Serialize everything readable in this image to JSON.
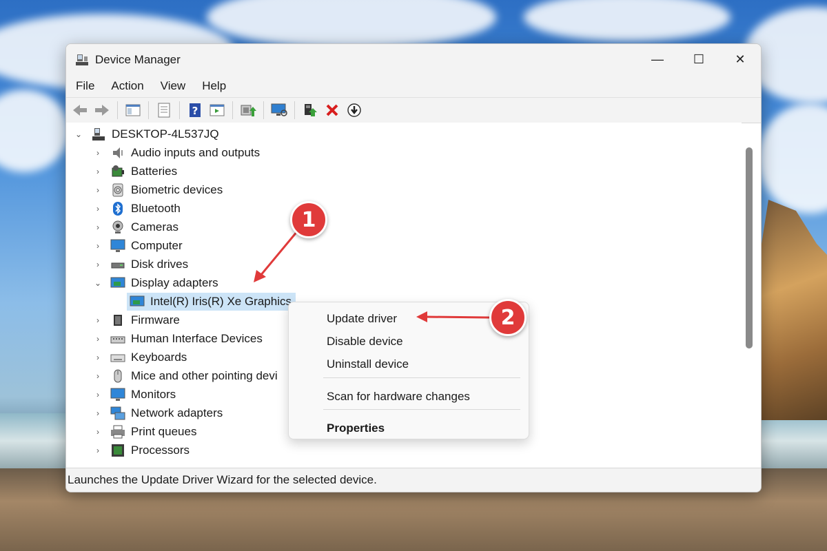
{
  "window": {
    "title": "Device Manager",
    "controls": {
      "minimize": "—",
      "maximize": "☐",
      "close": "✕"
    }
  },
  "menu": [
    "File",
    "Action",
    "View",
    "Help"
  ],
  "tree": {
    "root": "DESKTOP-4L537JQ",
    "items": [
      {
        "label": "Audio inputs and outputs",
        "icon": "speaker-icon",
        "expanded": false
      },
      {
        "label": "Batteries",
        "icon": "battery-icon",
        "expanded": false
      },
      {
        "label": "Biometric devices",
        "icon": "fingerprint-icon",
        "expanded": false
      },
      {
        "label": "Bluetooth",
        "icon": "bluetooth-icon",
        "expanded": false
      },
      {
        "label": "Cameras",
        "icon": "camera-icon",
        "expanded": false
      },
      {
        "label": "Computer",
        "icon": "monitor-icon",
        "expanded": false
      },
      {
        "label": "Disk drives",
        "icon": "disk-drive-icon",
        "expanded": false
      },
      {
        "label": "Display adapters",
        "icon": "display-adapter-icon",
        "expanded": true
      },
      {
        "label": "Intel(R) Iris(R) Xe Graphics",
        "icon": "display-adapter-icon",
        "child": true,
        "selected": true
      },
      {
        "label": "Firmware",
        "icon": "chip-icon",
        "expanded": false
      },
      {
        "label": "Human Interface Devices",
        "icon": "hid-icon",
        "expanded": false
      },
      {
        "label": "Keyboards",
        "icon": "keyboard-icon",
        "expanded": false
      },
      {
        "label": "Mice and other pointing devi",
        "icon": "mouse-icon",
        "expanded": false
      },
      {
        "label": "Monitors",
        "icon": "monitor-icon",
        "expanded": false
      },
      {
        "label": "Network adapters",
        "icon": "network-icon",
        "expanded": false
      },
      {
        "label": "Print queues",
        "icon": "printer-icon",
        "expanded": false
      },
      {
        "label": "Processors",
        "icon": "processor-icon",
        "expanded": false
      }
    ]
  },
  "context_menu": {
    "update": "Update driver",
    "disable": "Disable device",
    "uninstall": "Uninstall device",
    "scan": "Scan for hardware changes",
    "properties": "Properties"
  },
  "status": "Launches the Update Driver Wizard for the selected device.",
  "annotations": {
    "one": "1",
    "two": "2"
  },
  "colors": {
    "accent_red": "#e03a3a",
    "selection": "#cce4f7"
  }
}
